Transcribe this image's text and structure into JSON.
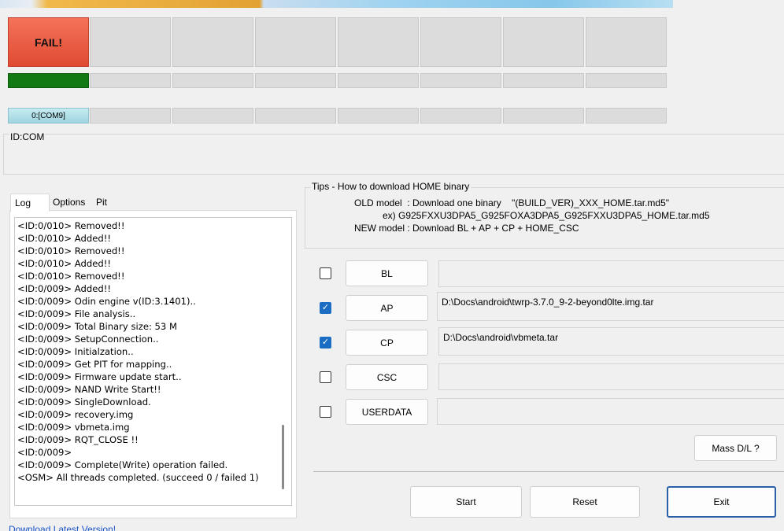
{
  "status": {
    "fail_label": "FAIL!",
    "com_port": "0:[COM9]",
    "id_com_label": "ID:COM"
  },
  "tabs": [
    {
      "label": "Log"
    },
    {
      "label": "Options"
    },
    {
      "label": "Pit"
    }
  ],
  "log": [
    "<ID:0/010> Removed!!",
    "<ID:0/010> Added!!",
    "<ID:0/010> Removed!!",
    "<ID:0/010> Added!!",
    "<ID:0/010> Removed!!",
    "<ID:0/009> Added!!",
    "<ID:0/009> Odin engine v(ID:3.1401)..",
    "<ID:0/009> File analysis..",
    "<ID:0/009> Total Binary size: 53 M",
    "<ID:0/009> SetupConnection..",
    "<ID:0/009> Initialzation..",
    "<ID:0/009> Get PIT for mapping..",
    "<ID:0/009> Firmware update start..",
    "<ID:0/009> NAND Write Start!!",
    "<ID:0/009> SingleDownload.",
    "<ID:0/009> recovery.img",
    "<ID:0/009> vbmeta.img",
    "<ID:0/009> RQT_CLOSE !!",
    "<ID:0/009>",
    "<ID:0/009> Complete(Write) operation failed.",
    "<OSM> All threads completed. (succeed 0 / failed 1)"
  ],
  "download_link": "Download Latest Version!",
  "tips": {
    "title": "Tips - How to download HOME binary",
    "old_model": "OLD model  : Download one binary    \"(BUILD_VER)_XXX_HOME.tar.md5\"",
    "example": "ex) G925FXXU3DPA5_G925FOXA3DPA5_G925FXXU3DPA5_HOME.tar.md5",
    "new_model": "NEW model : Download BL + AP + CP + HOME_CSC"
  },
  "files": [
    {
      "label": "BL",
      "checked": false,
      "path": ""
    },
    {
      "label": "AP",
      "checked": true,
      "path": "D:\\Docs\\android\\twrp-3.7.0_9-2-beyond0lte.img.tar"
    },
    {
      "label": "CP",
      "checked": true,
      "path": "D:\\Docs\\android\\vbmeta.tar"
    },
    {
      "label": "CSC",
      "checked": false,
      "path": ""
    },
    {
      "label": "USERDATA",
      "checked": false,
      "path": ""
    }
  ],
  "checkmark": "✓",
  "buttons": {
    "mass_dl": "Mass D/L ?",
    "start": "Start",
    "reset": "Reset",
    "exit": "Exit"
  },
  "colors": {
    "fail": "#e04a33",
    "progress": "#137a13",
    "com_active": "#9fd4de",
    "link": "#1a55c8"
  }
}
